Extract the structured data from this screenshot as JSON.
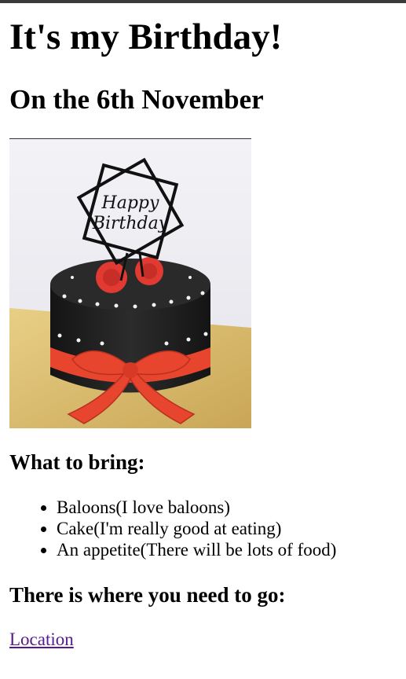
{
  "page": {
    "title": "It's my Birthday!",
    "subtitle": "On the 6th November",
    "image_alt": "Happy Birthday",
    "bring_heading": "What to bring:",
    "bring_items": [
      "Baloons(I love baloons)",
      "Cake(I'm really good at eating)",
      "An appetite(There will be lots of food)"
    ],
    "go_heading": "There is where you need to go:",
    "location_link": "Location"
  },
  "colors": {
    "link_visited": "#551a8b",
    "cake_body": "#1f1f1f",
    "ribbon": "#e8452f",
    "rose": "#e03a32",
    "board": "#d8b866"
  }
}
